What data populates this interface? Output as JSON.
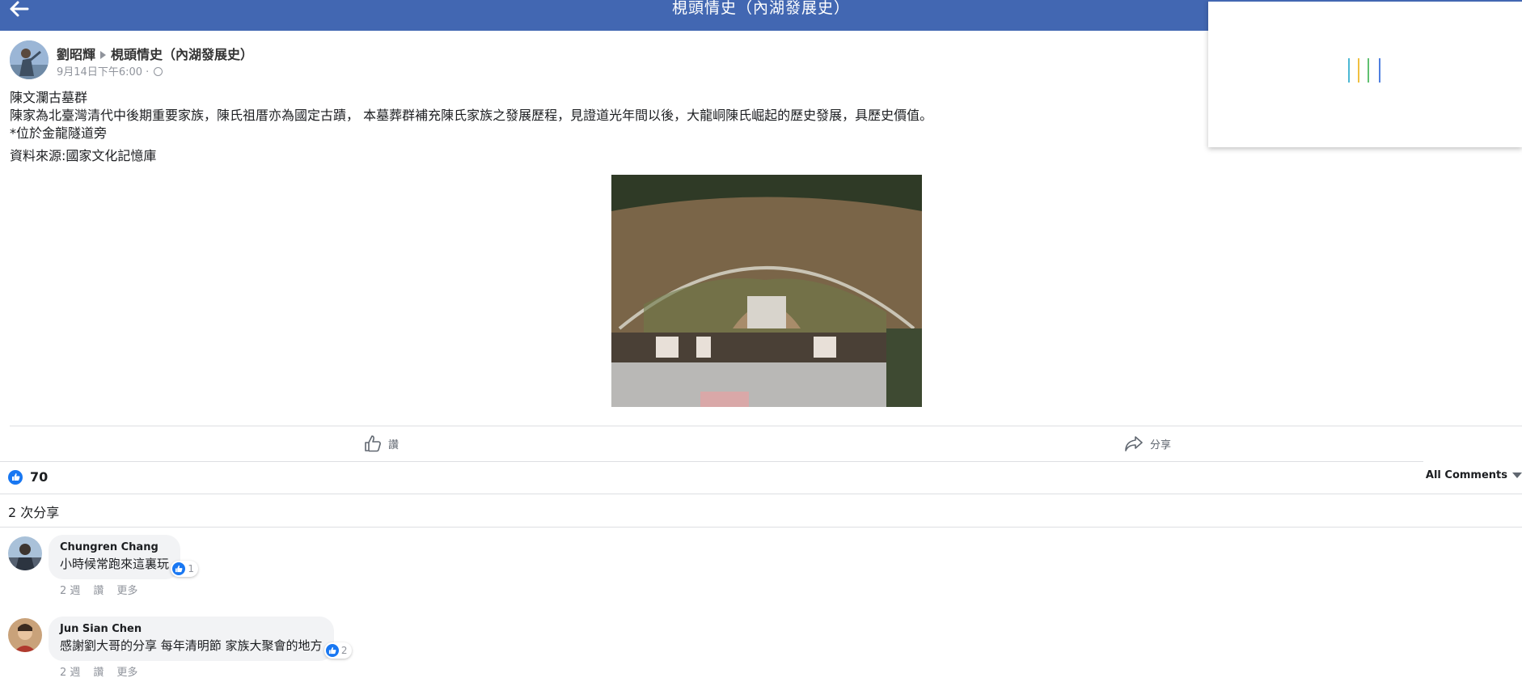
{
  "topbar": {
    "title": "梘頭情史（內湖發展史）"
  },
  "post": {
    "author": "劉昭輝",
    "group": "梘頭情史（內湖發展史）",
    "timestamp": "9月14日下午6:00 ·",
    "text_lines": [
      "陳文瀾古墓群",
      "陳家為北臺灣清代中後期重要家族，陳氏祖厝亦為國定古蹟， 本墓葬群補充陳氏家族之發展歷程，見證道光年間以後，大龍峒陳氏崛起的歷史發展，具歷史價值。",
      "*位於金龍隧道旁"
    ],
    "source_line": "資料來源:國家文化記憶庫"
  },
  "actions": {
    "like_label": "讚",
    "share_label": "分享"
  },
  "reactions": {
    "count": "70"
  },
  "comments_filter": {
    "label": "All Comments"
  },
  "shares": {
    "text": "2 次分享"
  },
  "comments": [
    {
      "name": "Chungren Chang",
      "text": "小時候常跑來這裏玩",
      "reaction_count": "1",
      "time": "2 週",
      "like": "讚",
      "more": "更多"
    },
    {
      "name": "Jun Sian Chen",
      "text": "感謝劉大哥的分享 每年清明節 家族大聚會的地方",
      "reaction_count": "2",
      "time": "2 週",
      "like": "讚",
      "more": "更多"
    }
  ],
  "colors": {
    "brand": "#4267b2",
    "like_blue": "#1877f2",
    "meta_grey": "#90949c",
    "bubble_bg": "#f2f3f5"
  },
  "icons": [
    "back-arrow-icon",
    "globe-icon",
    "thumbs-up-icon",
    "share-arrow-icon",
    "like-reaction-icon",
    "caret-down-icon",
    "loading-spinner-icon"
  ]
}
